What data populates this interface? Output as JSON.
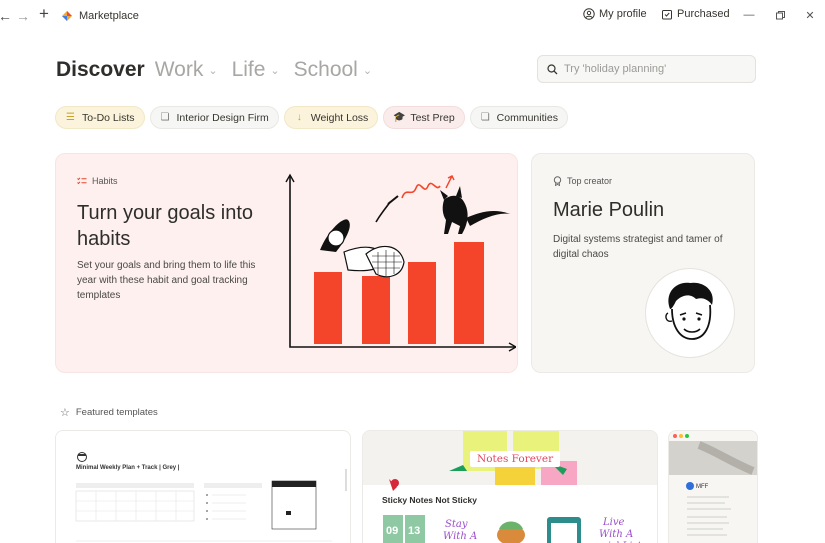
{
  "topbar": {
    "app_title": "Marketplace",
    "profile_label": "My profile",
    "purchased_label": "Purchased"
  },
  "tabs": [
    {
      "label": "Discover",
      "active": true
    },
    {
      "label": "Work",
      "active": false
    },
    {
      "label": "Life",
      "active": false
    },
    {
      "label": "School",
      "active": false
    }
  ],
  "search": {
    "placeholder": "Try 'holiday planning'"
  },
  "chips": [
    {
      "label": "To-Do Lists",
      "icon": "list-icon",
      "tone": "yellow"
    },
    {
      "label": "Interior Design Firm",
      "icon": "layers-icon",
      "tone": "gray"
    },
    {
      "label": "Weight Loss",
      "icon": "arrow-down-icon",
      "tone": "yellow"
    },
    {
      "label": "Test Prep",
      "icon": "graduation-cap-icon",
      "tone": "red"
    },
    {
      "label": "Communities",
      "icon": "layers-icon",
      "tone": "gray"
    }
  ],
  "hero": {
    "tag": "Habits",
    "title": "Turn your goals into habits",
    "description": "Set your goals and bring them to life this year with these habit and goal tracking templates"
  },
  "creator": {
    "tag": "Top creator",
    "name": "Marie Poulin",
    "description": "Digital systems strategist and tamer of digital chaos"
  },
  "featured": {
    "label": "Featured templates",
    "cards": [
      {
        "title": "Minimal Weekly Plan + Track | Grey |"
      },
      {
        "banner": "Notes Forever",
        "title": "Sticky Notes Not Sticky"
      },
      {
        "label": "MFF"
      }
    ]
  },
  "colors": {
    "accent_red": "#f4452b",
    "hero_bg": "#fdf0ee",
    "creator_bg": "#f7f6f3",
    "chip_yellow": "#fbf3db",
    "chip_red": "#fbecec"
  }
}
